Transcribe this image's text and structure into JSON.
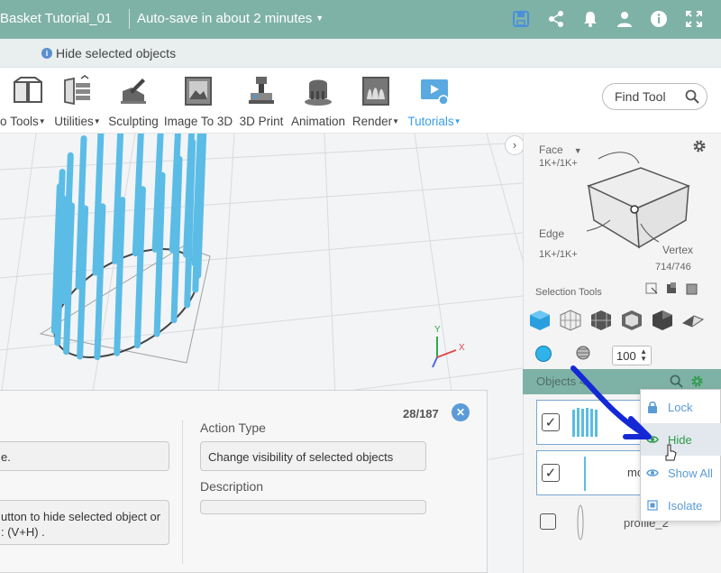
{
  "titlebar": {
    "document_name": "Basket Tutorial_01",
    "autosave": "Auto-save in about 2 minutes",
    "icons": [
      "save-icon",
      "share-icon",
      "bell-icon",
      "user-icon",
      "info-icon",
      "fullscreen-icon"
    ]
  },
  "tooltip": {
    "text": "Hide selected objects"
  },
  "toolbar": {
    "tools": [
      {
        "label": "Tools",
        "dropdown": true
      },
      {
        "label": "Utilities",
        "dropdown": true
      },
      {
        "label": "Sculpting",
        "dropdown": false
      },
      {
        "label": "Image To 3D",
        "dropdown": false
      },
      {
        "label": "3D Print",
        "dropdown": false
      },
      {
        "label": "Animation",
        "dropdown": false
      },
      {
        "label": "Render",
        "dropdown": true
      },
      {
        "label": "Tutorials",
        "dropdown": true
      }
    ],
    "find_tool": "Find Tool",
    "accent_color": "#3aa0e6"
  },
  "viewcube": {
    "face_label": "Face",
    "face_count": "1K+/1K+",
    "edge_label": "Edge",
    "edge_count": "1K+/1K+",
    "vertex_label": "Vertex",
    "vertex_count": "714/746"
  },
  "selection": {
    "title": "Selection Tools",
    "size_value": "100"
  },
  "objects": {
    "header": "Objects",
    "rows": [
      {
        "name": "",
        "checked": true
      },
      {
        "name": "mo",
        "checked": true
      },
      {
        "name": "profile_2",
        "checked": false
      }
    ]
  },
  "context_menu": {
    "items": [
      {
        "label": "Lock",
        "icon": "lock-icon"
      },
      {
        "label": "Hide",
        "icon": "eye-icon"
      },
      {
        "label": "Show All",
        "icon": "eye-icon"
      },
      {
        "label": "Isolate",
        "icon": "square-icon"
      }
    ],
    "hover_color": "#2e9a4a"
  },
  "tutorial": {
    "counter": "28/187",
    "field_a": "e.",
    "field_b_line1": "utton to hide selected object or",
    "field_b_line2": ": (V+H) .",
    "action_type_label": "Action Type",
    "action_type_value": "Change visibility of selected objects",
    "description_label": "Description"
  },
  "axis": {
    "y": "Y",
    "x": "X"
  },
  "colors": {
    "header_teal": "#7fb2a6",
    "model_blue": "#5bbce6",
    "arrow_blue": "#1428d6"
  }
}
